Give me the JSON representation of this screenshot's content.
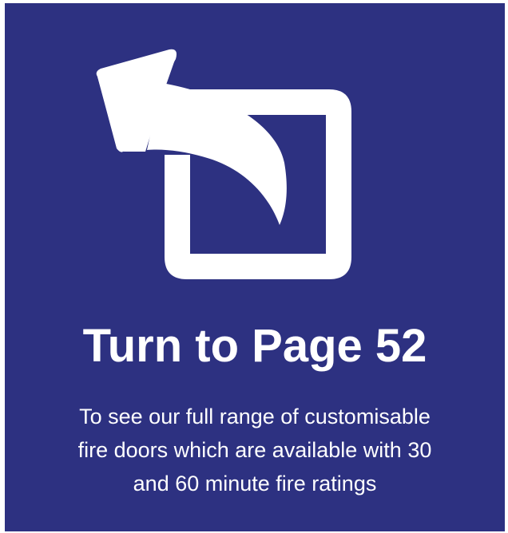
{
  "card": {
    "background_color": "#2d3181",
    "foreground_color": "#ffffff",
    "icon": "external-link-arrow-icon",
    "title": "Turn to Page 52",
    "body_lines": [
      "To see our full range of customisable",
      "fire doors which are available with 30",
      "and 60 minute fire ratings"
    ]
  }
}
